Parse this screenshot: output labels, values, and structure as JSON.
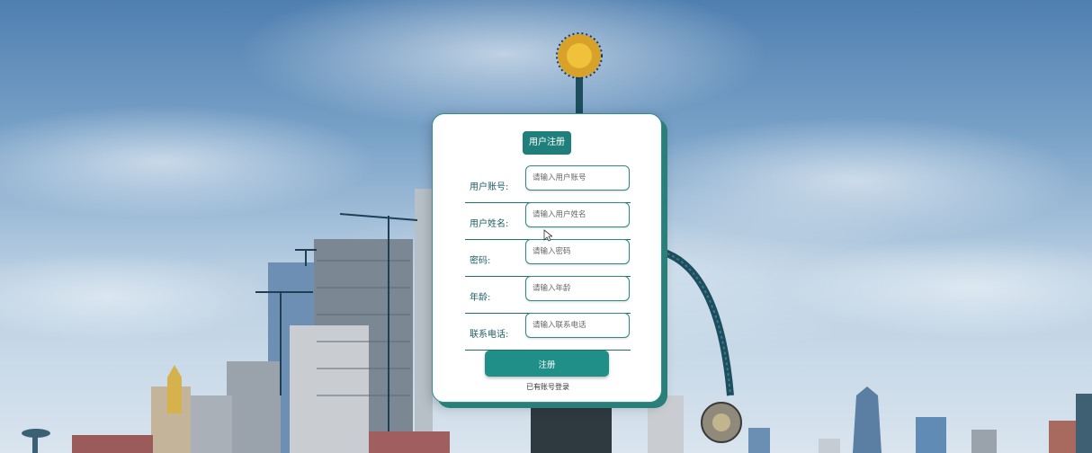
{
  "form": {
    "title": "用户注册",
    "fields": [
      {
        "label": "用户账号:",
        "placeholder": "请输入用户账号",
        "value": ""
      },
      {
        "label": "用户姓名:",
        "placeholder": "请输入用户姓名",
        "value": ""
      },
      {
        "label": "密码:",
        "placeholder": "请输入密码",
        "value": ""
      },
      {
        "label": "年龄:",
        "placeholder": "请输入年龄",
        "value": ""
      },
      {
        "label": "联系电话:",
        "placeholder": "请输入联系电话",
        "value": ""
      }
    ],
    "submit_label": "注册",
    "login_link": "已有账号登录"
  },
  "colors": {
    "accent": "#1f8f88",
    "title_badge": "#1f7f7b",
    "label_text": "#1f5f66",
    "card_background": "#ffffff"
  },
  "background": {
    "description_icon": "city-skyline-background"
  }
}
